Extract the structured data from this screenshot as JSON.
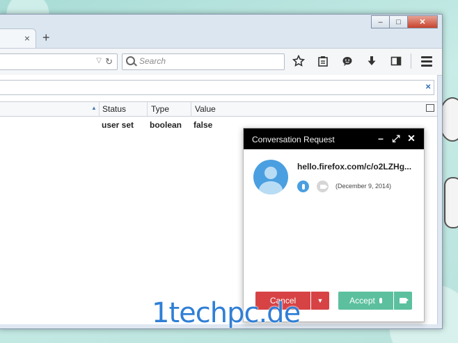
{
  "browser": {
    "tab": {
      "close_glyph": "×"
    },
    "new_tab_glyph": "+",
    "search": {
      "placeholder": "Search"
    },
    "window_controls": {
      "minimize": "–",
      "maximize": "□",
      "close": "✕"
    },
    "toolbar_icons": [
      "bookmark-star-icon",
      "reading-list-icon",
      "hello-chat-icon",
      "downloads-icon",
      "sidebar-icon",
      "menu-icon"
    ]
  },
  "config_table": {
    "filter_clear_glyph": "×",
    "columns": [
      "Status",
      "Type",
      "Value"
    ],
    "rows": [
      {
        "status": "user set",
        "type": "boolean",
        "value": "false"
      }
    ]
  },
  "conversation": {
    "title": "Conversation Request",
    "controls": {
      "minimize": "–",
      "expand": "⤢",
      "close": "✕"
    },
    "url": "hello.firefox.com/c/o2LZHg...",
    "date": "(December 9, 2014)",
    "cancel_label": "Cancel",
    "cancel_drop_glyph": "▼",
    "accept_label": "Accept",
    "colors": {
      "header": "#000000",
      "avatar": "#4a9fe0",
      "cancel": "#d74345",
      "accept": "#5cc09f"
    }
  },
  "watermark": "1techpc.de"
}
